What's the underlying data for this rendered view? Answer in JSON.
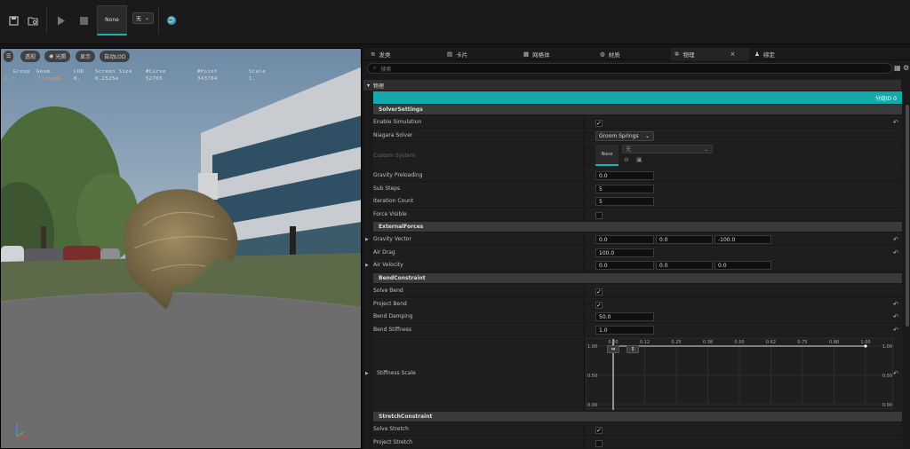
{
  "toolbar": {
    "save_icon": "save-icon",
    "browse_icon": "browse-icon",
    "play_icon": "play-icon",
    "stop_icon": "stop-icon",
    "thumb_label": "None",
    "dropdown": "无",
    "globe_icon": "globe-icon"
  },
  "viewport": {
    "buttons": [
      "透视",
      "光照",
      "显示",
      "自动LOD"
    ],
    "menu_icon": "hamburger-icon",
    "stats_headers": [
      "Group",
      "Geom.",
      "LOD",
      "Screen Size",
      "#Curve",
      "#Point",
      "Scale"
    ],
    "stats_values": [
      "# 0",
      "Strands",
      "0.",
      "0.2525e",
      "52705",
      "343704",
      "1."
    ]
  },
  "tabs": [
    "发类",
    "卡片",
    "网格体",
    "材质",
    "物理",
    "绑定"
  ],
  "search_placeholder": "搜索",
  "category": "物理",
  "group_label": "分组ID 0",
  "sections": {
    "solver": "SolverSettings",
    "external": "ExternalForces",
    "bend": "BendConstraint",
    "stretch": "StretchConstraint"
  },
  "rows": {
    "enable_simulation": "Enable Simulation",
    "niagara_solver": "Niagara Solver",
    "niagara_solver_value": "Groom Springs",
    "custom_system": "Custom System",
    "custom_system_thumb": "None",
    "custom_system_value": "无",
    "gravity_preloading": "Gravity Preloading",
    "gravity_preloading_value": "0.0",
    "sub_steps": "Sub Steps",
    "sub_steps_value": "5",
    "iteration_count": "Iteration Count",
    "iteration_count_value": "5",
    "force_visible": "Force Visible",
    "gravity_vector": "Gravity Vector",
    "gravity_vector_values": [
      "0.0",
      "0.0",
      "-100.0"
    ],
    "air_drag": "Air Drag",
    "air_drag_value": "100.0",
    "air_velocity": "Air Velocity",
    "air_velocity_values": [
      "0.0",
      "0.0",
      "0.0"
    ],
    "solve_bend": "Solve Bend",
    "project_bend": "Project Bend",
    "bend_damping": "Bend Damping",
    "bend_damping_value": "50.0",
    "bend_stiffness": "Bend Stiffness",
    "bend_stiffness_value": "1.0",
    "stiffness_scale": "Stiffness Scale",
    "solve_stretch": "Solve Stretch",
    "project_stretch": "Project Stretch"
  },
  "curve": {
    "x_ticks": [
      "0.00",
      "0.12",
      "0.25",
      "0.38",
      "0.50",
      "0.62",
      "0.75",
      "0.88",
      "1.00"
    ],
    "y_left": [
      "1.00",
      "0.50",
      "0.00"
    ],
    "y_right": [
      "1.00",
      "0.50",
      "0.00"
    ],
    "value": 1.0
  }
}
